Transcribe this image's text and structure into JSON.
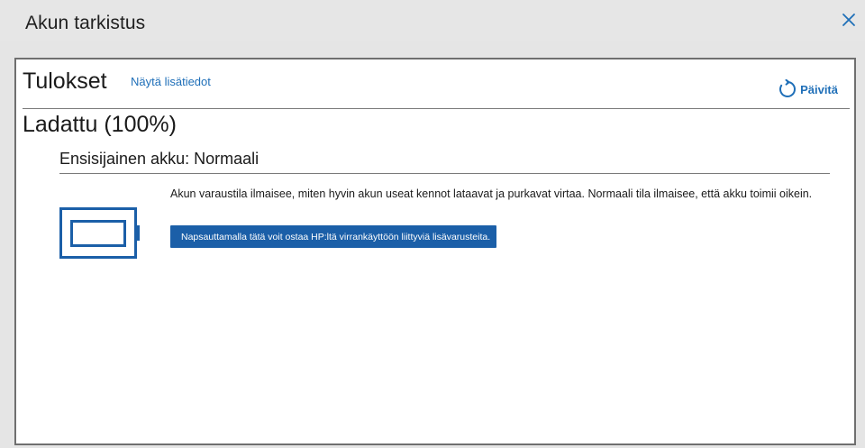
{
  "window": {
    "title": "Akun tarkistus"
  },
  "results": {
    "title": "Tulokset",
    "details_link": "Näytä lisätiedot",
    "refresh_label": "Päivitä"
  },
  "charge": {
    "status": "Ladattu (100%)"
  },
  "battery": {
    "heading": "Ensisijainen akku: Normaali",
    "description": "Akun varaustila ilmaisee, miten hyvin akun useat kennot lataavat ja purkavat virtaa. Normaali tila ilmaisee, että akku toimii oikein.",
    "accessory_button": "Napsauttamalla tätä voit ostaa HP:ltä virrankäyttöön liittyviä lisävarusteita.",
    "icon": "battery-icon"
  },
  "colors": {
    "accent": "#1b5fa8",
    "link": "#1f6fb8",
    "titlebar": "#e6e6e6"
  }
}
